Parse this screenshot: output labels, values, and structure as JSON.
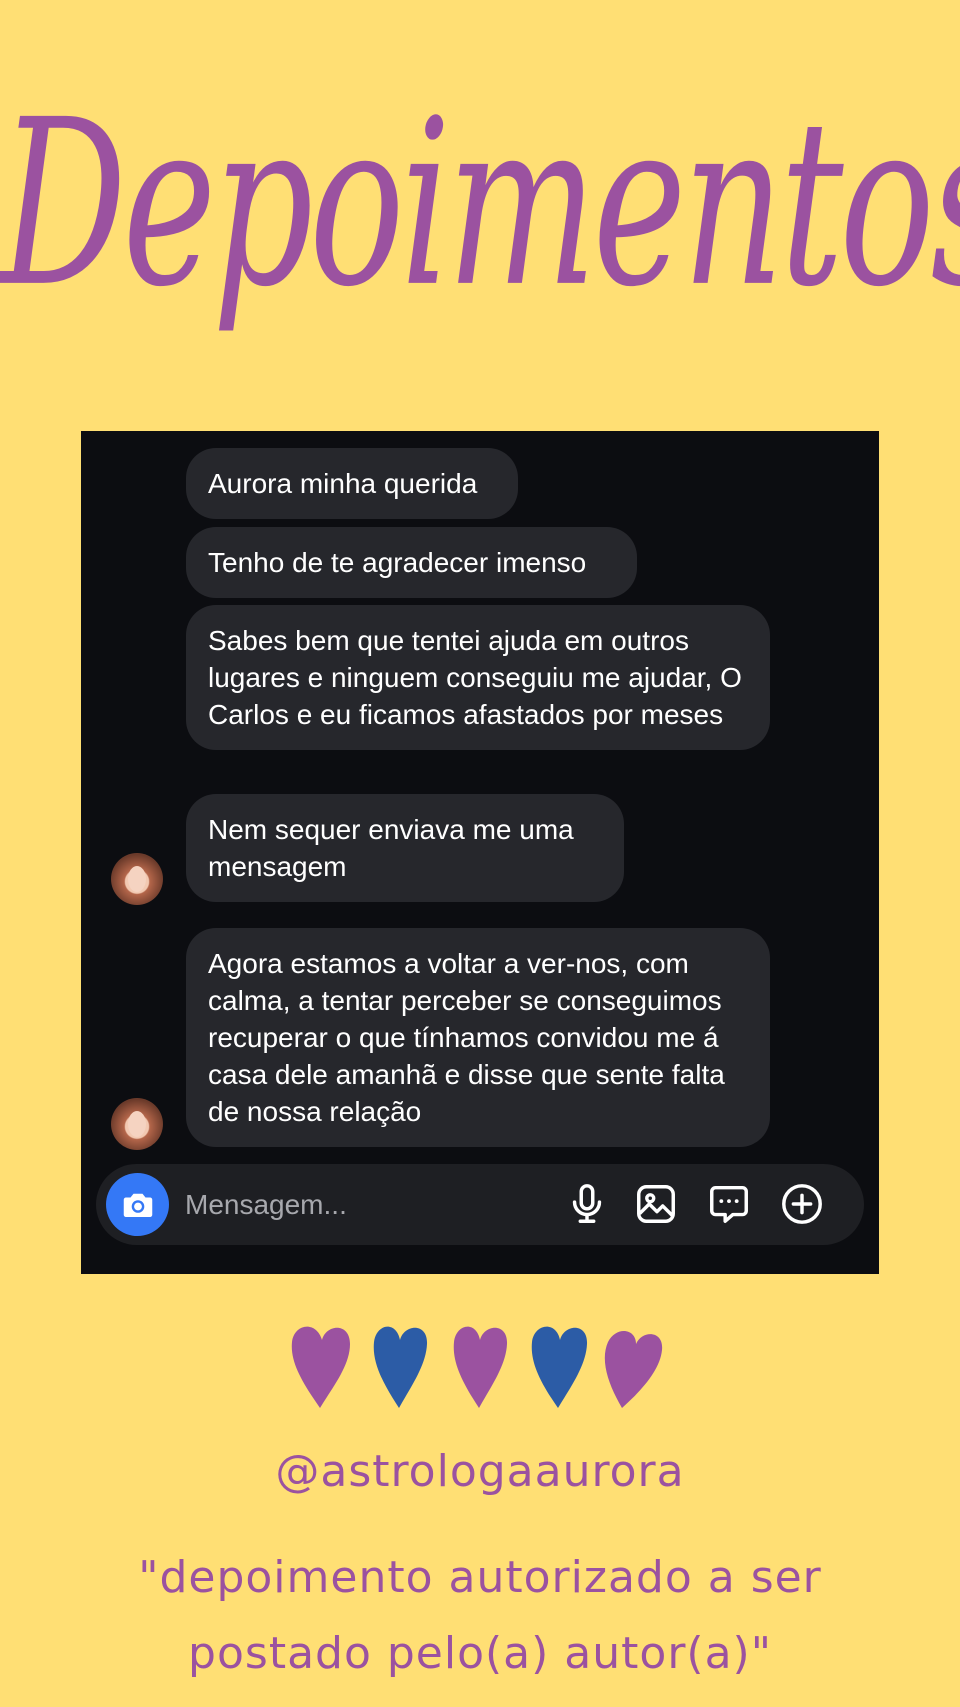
{
  "title": "Depoimentos",
  "chat": {
    "messages": [
      {
        "text": "Aurora minha querida"
      },
      {
        "text": "Tenho de te agradecer imenso"
      },
      {
        "text": "Sabes bem que tentei ajuda em outros lugares e ninguem conseguiu me ajudar, O Carlos e eu ficamos afastados por meses"
      },
      {
        "text": "Nem sequer enviava me uma mensagem"
      },
      {
        "text": "Agora estamos a voltar a ver-nos, com calma, a tentar perceber se conseguimos recuperar o que tínhamos convidou me á casa dele amanhã e disse que sente falta de nossa relação"
      }
    ],
    "composer": {
      "placeholder": "Mensagem...",
      "icons": [
        "camera-icon",
        "microphone-icon",
        "image-icon",
        "chat-bubble-icon",
        "add-circle-icon"
      ]
    }
  },
  "hearts": {
    "colors": [
      "#9B52A0",
      "#2C5CA6",
      "#9B52A0",
      "#2C5CA6",
      "#9B52A0"
    ]
  },
  "footer": {
    "handle": "@astrologaaurora",
    "note": "\"depoimento autorizado a ser postado pelo(a) autor(a)\""
  },
  "colors": {
    "background": "#FFDF74",
    "accent": "#9B52A0",
    "bubble": "#26272C",
    "camera_button": "#3478F6"
  }
}
